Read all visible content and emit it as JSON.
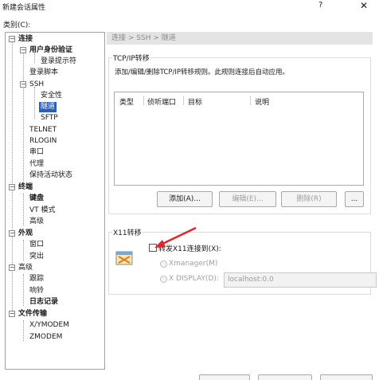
{
  "window": {
    "title": "新建会话属性",
    "help_icon": "?",
    "close_icon": "✕"
  },
  "category_label": "类别(C):",
  "tree": {
    "connection": "连接",
    "user_auth": "用户身份验证",
    "login_prompt": "登录提示符",
    "login_script": "登录脚本",
    "ssh": "SSH",
    "security": "安全性",
    "tunnel": "隧道",
    "sftp": "SFTP",
    "telnet": "TELNET",
    "rlogin": "RLOGIN",
    "serial": "串口",
    "proxy": "代理",
    "keepalive": "保持活动状态",
    "terminal": "终端",
    "keyboard": "键盘",
    "vt_mode": "VT 模式",
    "advanced1": "高级",
    "appearance": "外观",
    "window": "窗口",
    "highlight": "突出",
    "advanced": "高级",
    "trace": "跟踪",
    "bell": "响铃",
    "logging": "日志记录",
    "file_transfer": "文件传输",
    "xymodem": "X/YMODEM",
    "zmodem": "ZMODEM",
    "expand_minus": "−"
  },
  "breadcrumb": "连接 > SSH > 隧道",
  "tcpip": {
    "title": "TCP/IP转移",
    "description": "添加/编辑/删除TCP/IP转移规则。此规则连接后自动应用。",
    "columns": [
      "类型",
      "侦听端口",
      "目标",
      "说明"
    ],
    "add_button": "添加(A)...",
    "edit_button": "编辑(E)...",
    "delete_button": "删除(R)",
    "more_button": "..."
  },
  "x11": {
    "title": "X11转移",
    "forward_label": "转发X11连接到(X):",
    "forward_checked": false,
    "xmanager_label": "Xmanager(M)",
    "xdisplay_label": "X DISPLAY(D):",
    "xdisplay_value": "localhost:0.0"
  },
  "colors": {
    "selection": "#2b5fb5",
    "annotation_arrow": "#e0262a"
  }
}
